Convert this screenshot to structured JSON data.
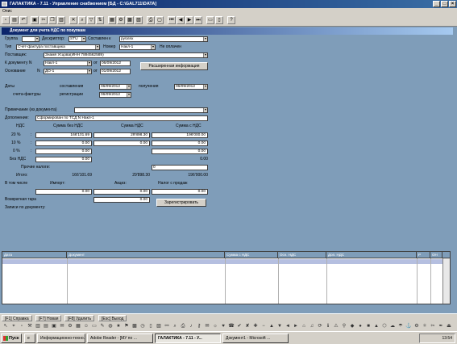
{
  "window": {
    "title": "ГАЛАКТИКА - 7.11 - Управление снабжением [БД - C:\\GAL711\\DATA]"
  },
  "menu": {
    "label": "Опис"
  },
  "doc": {
    "title": "Документ для учета НДС по покупкам",
    "group_label": "Группа",
    "group_value": "",
    "descriptor_label": "Дескриптор:",
    "descriptor_value": "STU",
    "composed_label": "Составлен к",
    "composed_value": "рублях",
    "type_label": "Тип",
    "type_value": "Счет-фактура поставщика",
    "number_label": "Номер",
    "number_value": "Накл-1",
    "paid_status": "Не оплачен",
    "supplier_label": "Поставщик:",
    "supplier_value": "Знамя Усцова(ИНН 7894562589)",
    "todoc_label": "К документу N",
    "todoc_value": "Накл-1",
    "from_label": "от",
    "todoc_date": "06/09/2012",
    "basis_label": "Основание",
    "basis_n": "N",
    "basis_value": "ДО-1",
    "basis_date": "01/09/2012",
    "ext_info_button": "Расширенная информация",
    "dates_label": "Даты",
    "compiled_label": "составления",
    "compiled_date": "06/09/2012",
    "received_label": "получения",
    "received_date": "06/09/2012",
    "invoice_label": "счета-фактуры",
    "registration_label": "регистрации",
    "registration_date": "06/09/2012",
    "note_label": "Примечание (из документа)",
    "note_value": "",
    "addition_label": "Дополнение:",
    "addition_value": "Сформирован по ТСД N Накл-1",
    "vat_header": "НДС",
    "sum_no_vat_header": "Сумма без НДС",
    "vat_sum_header": "Сумма НДС",
    "sum_with_vat_header": "Сумма с НДС",
    "rows": [
      {
        "rate": "20 %",
        "no_vat": "166'101.69",
        "vat": "29'898.30",
        "with_vat": "196'000.00"
      },
      {
        "rate": "10 %",
        "no_vat": "0.00",
        "vat": "0.00",
        "with_vat": "0.00"
      },
      {
        "rate": "0 %",
        "no_vat": "0.00",
        "vat": "",
        "with_vat": "0.00"
      },
      {
        "rate": "Без НДС",
        "no_vat": "0.00",
        "vat": "",
        "with_vat": "0.00"
      }
    ],
    "other_taxes_label": "Прочие налоги:",
    "other_taxes_value": "0",
    "total_label": "Итого:",
    "total_no_vat": "166'101.69",
    "total_vat": "29'898.30",
    "total_with_vat": "196'000.00",
    "incl_label": "В том числе",
    "import_label": "Импорт:",
    "import_value": "0.00",
    "excise_label": "Акциз:",
    "excise_value": "0.00",
    "sales_tax_label": "Налог с продаж",
    "sales_tax_value": "0.00",
    "return_label": "Возвратная тара",
    "return_value": "0.00",
    "records_label": "Записи по документу:",
    "register_button": "Зарегистрировать"
  },
  "grid": {
    "columns": [
      "Дата",
      "Документ",
      "Сумма с НДС",
      "Осн. НДС",
      "Доп. НДС",
      "Р",
      "ОН"
    ]
  },
  "fkeys": [
    "[F1] Справка",
    "[F7] Новая",
    "[F8] Удалить",
    "[Esc] Выход"
  ],
  "taskbar": {
    "start": "Пуск",
    "tasks": [
      "Информационно-техно...",
      "Adobe Reader - [МУ по ...",
      "ГАЛАКТИКА - 7.11 - У...",
      "Документ1 - Microsoft ..."
    ],
    "clock": "13:54"
  }
}
